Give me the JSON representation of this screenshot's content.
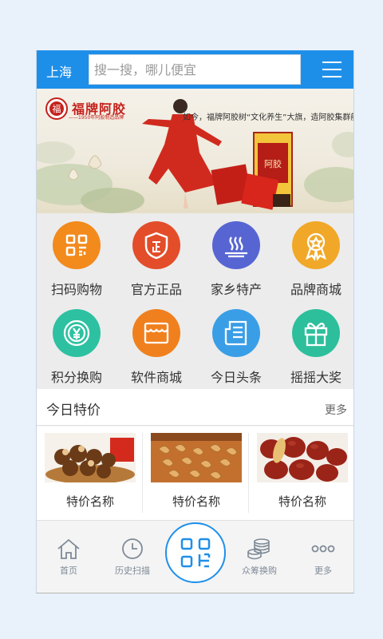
{
  "header": {
    "city": "上海",
    "search_placeholder": "搜一搜，哪儿便宜"
  },
  "banner": {
    "brand": "福牌阿胶",
    "brand_sub": "——1950年阿胶制造品牌",
    "slogan": "如今，福牌阿胶树“文化养生”大旗，造阿胶集群航母",
    "product_label": "阿胶"
  },
  "categories": [
    {
      "label": "扫码购物",
      "icon": "qr-icon",
      "color": "#f28a1c"
    },
    {
      "label": "官方正品",
      "icon": "shield-icon",
      "color": "#e34d2a"
    },
    {
      "label": "家乡特产",
      "icon": "steam-dish-icon",
      "color": "#5765d3"
    },
    {
      "label": "品牌商城",
      "icon": "medal-icon",
      "color": "#f1a828"
    },
    {
      "label": "积分换购",
      "icon": "yen-coin-icon",
      "color": "#2dc1a1"
    },
    {
      "label": "软件商城",
      "icon": "shop-icon",
      "color": "#f0801e"
    },
    {
      "label": "今日头条",
      "icon": "news-icon",
      "color": "#3a9ee6"
    },
    {
      "label": "摇摇大奖",
      "icon": "gift-icon",
      "color": "#2dbf9c"
    }
  ],
  "deals": {
    "title": "今日特价",
    "more": "更多",
    "items": [
      {
        "name": "特价名称"
      },
      {
        "name": "特价名称"
      },
      {
        "name": "特价名称"
      }
    ]
  },
  "tabbar": {
    "items": [
      {
        "label": "首页",
        "icon": "home-icon"
      },
      {
        "label": "历史扫描",
        "icon": "clock-icon"
      },
      {
        "label": "",
        "icon": "scan-icon"
      },
      {
        "label": "众筹换购",
        "icon": "coins-icon"
      },
      {
        "label": "更多",
        "icon": "more-icon"
      }
    ]
  },
  "colors": {
    "primary": "#1e8fe9",
    "brand_red": "#c5221c"
  }
}
